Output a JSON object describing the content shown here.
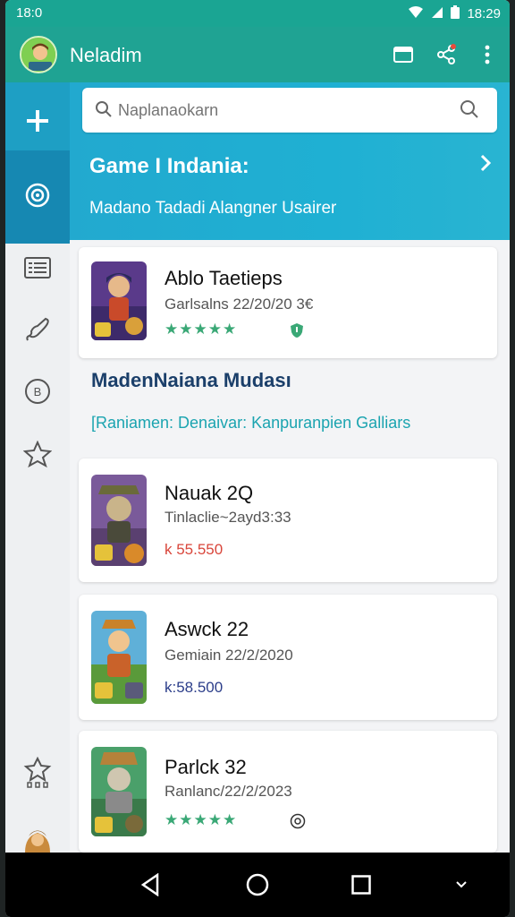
{
  "status": {
    "time": "18:0",
    "battery_time": "18:29"
  },
  "appbar": {
    "title": "Neladim",
    "avatar_label": "Tetian"
  },
  "search": {
    "placeholder": "Naplanaokarn"
  },
  "hero": {
    "title": "Game I Indania:",
    "subtitle": "Madano Tadadi Alangner Usairer"
  },
  "featured_card": {
    "title": "Ablo Taetieps",
    "date": "Garlsalns 22/20/20 3€",
    "stars": "★★★★★"
  },
  "section": {
    "title": "MadenNaiana Mudası",
    "subtitle": "[Raniamen: Denaivar: Kanpuranpien Galliars"
  },
  "list": [
    {
      "title": "Nauak 2Q",
      "date": "Tinlaclie~2ayd3:33",
      "price": "k 55.550",
      "price_color": "#d9463b"
    },
    {
      "title": "Aswck 22",
      "date": "Gemiain 22/2/2020",
      "price": "k:58.500",
      "price_color": "#2c3e8a"
    },
    {
      "title": "Parlck 32",
      "date": "Ranlanc/22/2/2023",
      "stars": "★★★★★"
    }
  ],
  "colors": {
    "primary": "#1fa393",
    "hero": "#22a9cf",
    "active_tab": "#1688b2",
    "star": "#3aa876"
  }
}
